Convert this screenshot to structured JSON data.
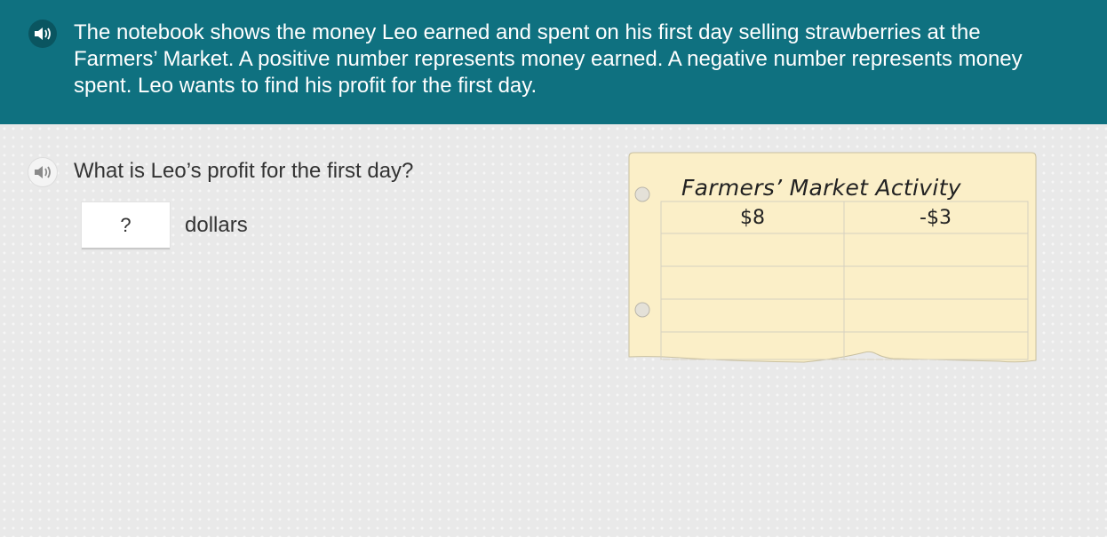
{
  "intro": {
    "text": "The notebook shows the money Leo earned and spent on his first day selling strawberries at the Farmers’ Market. A positive number represents money earned. A negative number represents money spent. Leo wants to find his profit for the first day."
  },
  "question": {
    "text": "What is Leo’s profit for the first day?",
    "answer_placeholder": "?",
    "unit": "dollars"
  },
  "notebook": {
    "title": "Farmers’ Market Activity",
    "rows": [
      [
        "$8",
        "-$3"
      ],
      [
        "",
        ""
      ],
      [
        "",
        ""
      ],
      [
        "",
        ""
      ]
    ]
  },
  "colors": {
    "banner": "#0f7180",
    "background": "#e9e9e9",
    "paper": "#fbefc8"
  },
  "icons": {
    "speaker": "speaker-icon"
  }
}
